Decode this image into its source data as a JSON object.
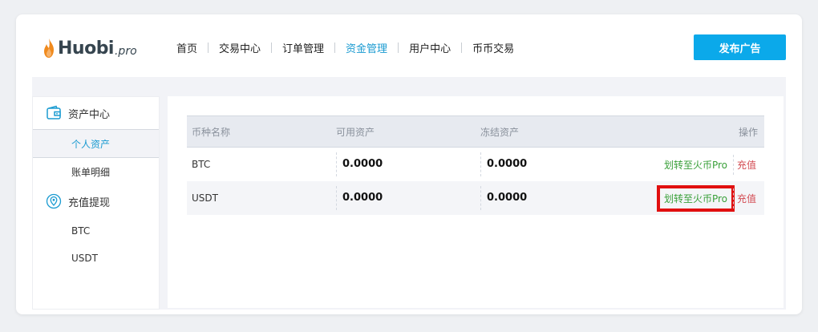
{
  "header": {
    "logo_text": "Huobi",
    "logo_suffix": ".pro",
    "nav": [
      {
        "label": "首页",
        "active": false
      },
      {
        "label": "交易中心",
        "active": false
      },
      {
        "label": "订单管理",
        "active": false
      },
      {
        "label": "资金管理",
        "active": true
      },
      {
        "label": "用户中心",
        "active": false
      },
      {
        "label": "币币交易",
        "active": false
      }
    ],
    "publish_button": "发布广告"
  },
  "sidebar": {
    "groups": [
      {
        "title": "资产中心",
        "icon": "wallet-icon",
        "items": [
          "个人资产",
          "账单明细"
        ],
        "active_item": "个人资产"
      },
      {
        "title": "充值提现",
        "icon": "location-pin-icon",
        "items": [
          "BTC",
          "USDT"
        ],
        "active_item": ""
      }
    ]
  },
  "assets_table": {
    "headers": {
      "coin": "币种名称",
      "available": "可用资产",
      "frozen": "冻结资产",
      "ops": "操作"
    },
    "rows": [
      {
        "coin": "BTC",
        "available": "0.0000",
        "frozen": "0.0000",
        "transfer_label": "划转至火币Pro",
        "recharge_label": "充值",
        "highlighted": false
      },
      {
        "coin": "USDT",
        "available": "0.0000",
        "frozen": "0.0000",
        "transfer_label": "划转至火币Pro",
        "recharge_label": "充值",
        "highlighted": true
      }
    ]
  },
  "colors": {
    "accent": "#0ba9ea",
    "active_text": "#1b9bd1",
    "transfer_link": "#3aa03a",
    "recharge_link": "#d34c53",
    "highlight_box": "#e10f0f"
  }
}
